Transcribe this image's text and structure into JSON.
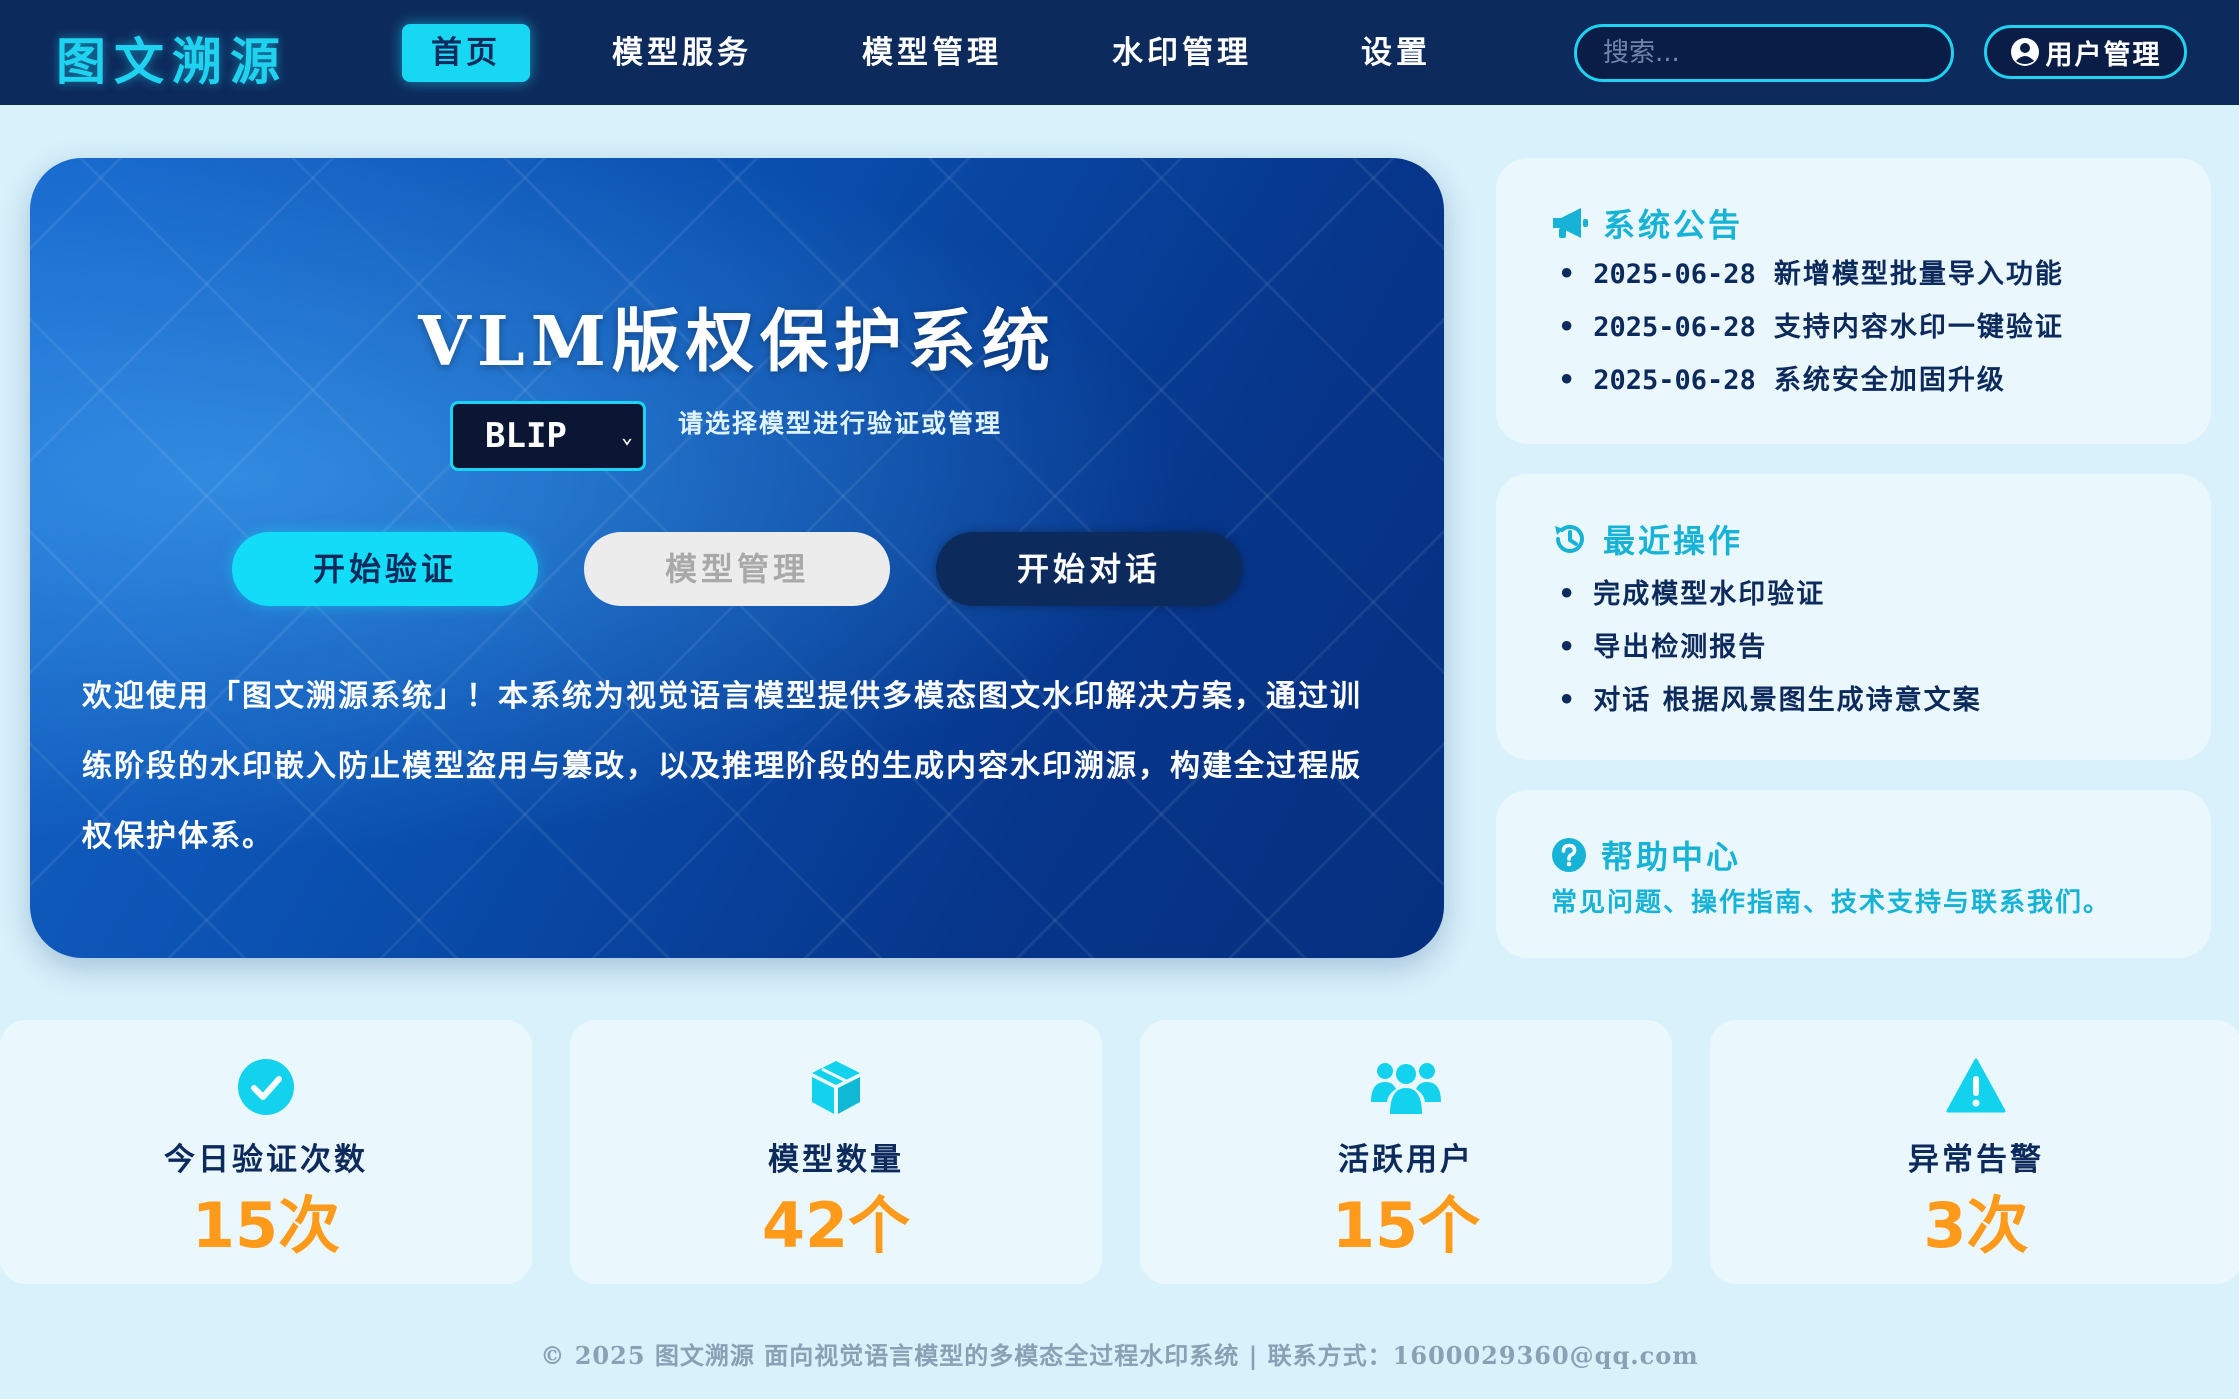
{
  "header": {
    "logo": "图文溯源",
    "nav": [
      "首页",
      "模型服务",
      "模型管理",
      "水印管理",
      "设置"
    ],
    "active_nav": "首页",
    "search_placeholder": "搜索...",
    "user_button": "用户管理",
    "user_icon": "user-circle-icon"
  },
  "hero": {
    "title": "VLM版权保护系统",
    "model_select_value": "BLIP",
    "select_hint": "请选择模型进行验证或管理",
    "buttons": {
      "verify": "开始验证",
      "manage": "模型管理",
      "chat": "开始对话"
    },
    "description": "欢迎使用「图文溯源系统」！本系统为视觉语言模型提供多模态图文水印解决方案，通过训练阶段的水印嵌入防止模型盗用与篡改，以及推理阶段的生成内容水印溯源，构建全过程版权保护体系。"
  },
  "announcements": {
    "title": "系统公告",
    "icon": "megaphone-icon",
    "items": [
      {
        "date": "2025-06-28",
        "text": "新增模型批量导入功能"
      },
      {
        "date": "2025-06-28",
        "text": "支持内容水印一键验证"
      },
      {
        "date": "2025-06-28",
        "text": "系统安全加固升级"
      }
    ]
  },
  "recent": {
    "title": "最近操作",
    "icon": "history-icon",
    "items": [
      "完成模型水印验证",
      "导出检测报告",
      "对话 根据风景图生成诗意文案"
    ]
  },
  "help": {
    "title": "帮助中心",
    "icon": "question-circle-icon",
    "text": "常见问题、操作指南、技术支持与联系我们。"
  },
  "stats": [
    {
      "label": "今日验证次数",
      "value": "15次",
      "icon": "check-circle-icon"
    },
    {
      "label": "模型数量",
      "value": "42个",
      "icon": "cube-icon"
    },
    {
      "label": "活跃用户",
      "value": "15个",
      "icon": "users-icon"
    },
    {
      "label": "异常告警",
      "value": "3次",
      "icon": "warning-icon"
    }
  ],
  "footer": "© 2025 图文溯源 面向视觉语言模型的多模态全过程水印系统 | 联系方式：1600029360@qq.com",
  "colors": {
    "header_bg": "#0d2a5c",
    "accent": "#17d7f2",
    "stat_value": "#ff9a1a",
    "page_bg": "#d8f1fb"
  }
}
